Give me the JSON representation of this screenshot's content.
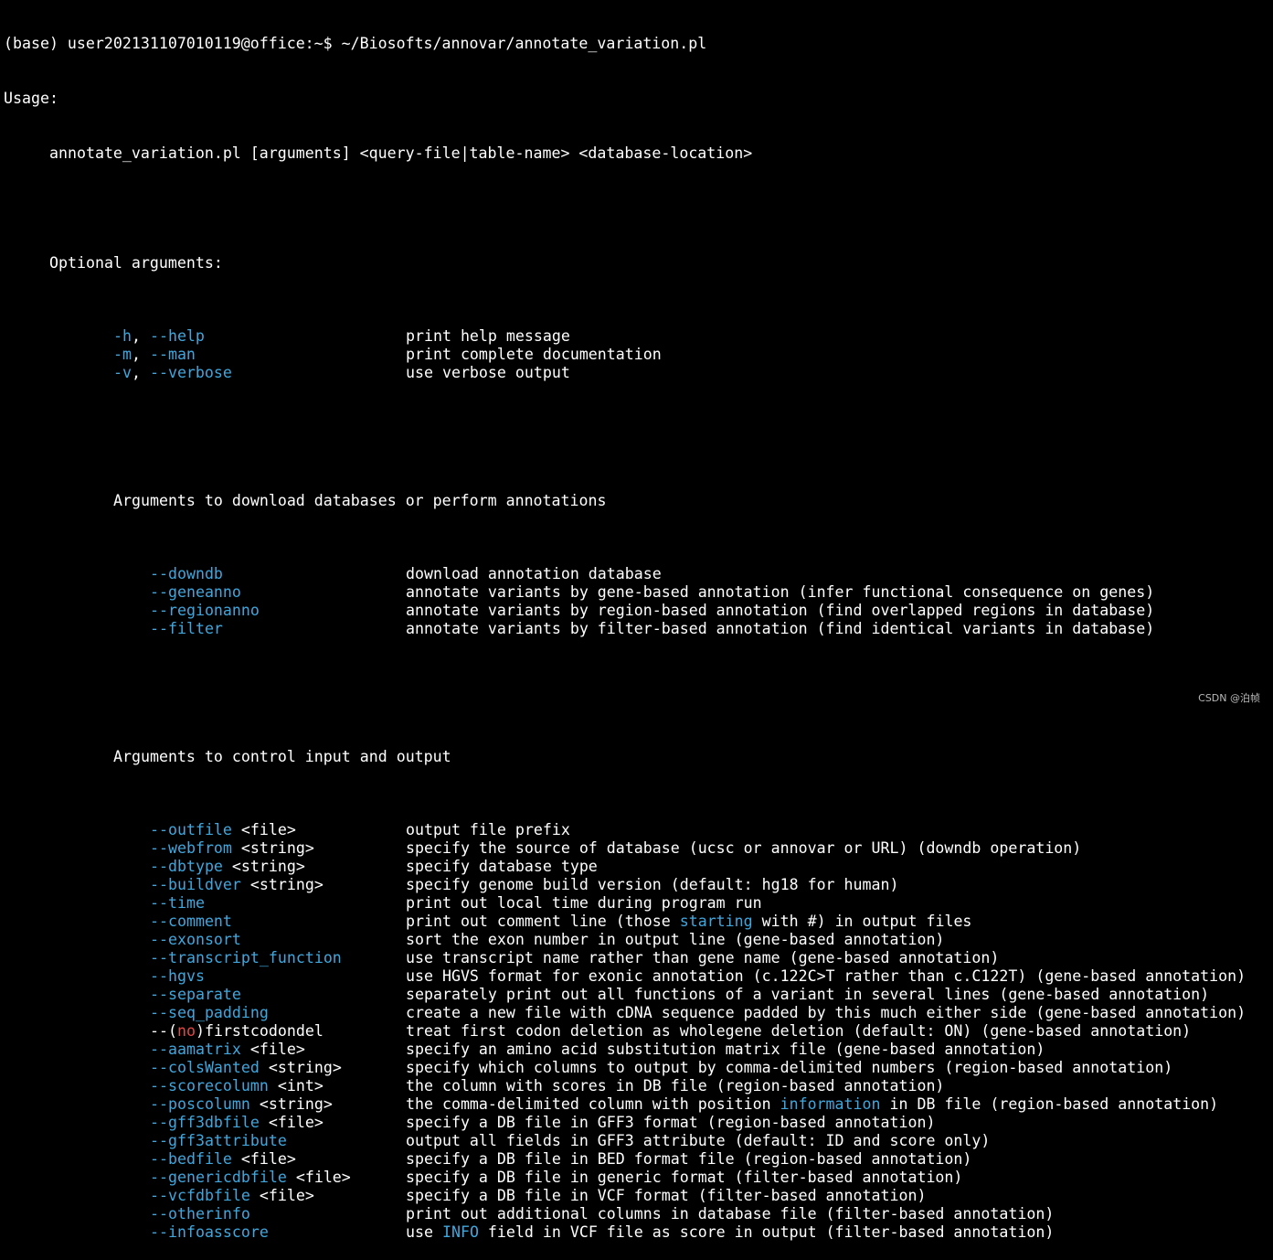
{
  "terminal": {
    "prompt_line": "(base) user202131107010119@office:~$ ~/Biosofts/annovar/annotate_variation.pl",
    "usage_label": "Usage:",
    "usage_line": "annotate_variation.pl [arguments] <query-file|table-name> <database-location>",
    "optional_header": "Optional arguments:",
    "section1": [
      {
        "opt": "-h, --help",
        "hl": "-h",
        "sep": ", ",
        "hl2": "--help",
        "rest": "",
        "desc": "print help message"
      },
      {
        "opt": "-m, --man",
        "hl": "-m",
        "sep": ", ",
        "hl2": "--man",
        "rest": "",
        "desc": "print complete documentation"
      },
      {
        "opt": "-v, --verbose",
        "hl": "-v",
        "sep": ", ",
        "hl2": "--verbose",
        "rest": "",
        "desc": "use verbose output"
      }
    ],
    "download_header": "Arguments to download databases or perform annotations",
    "section2": [
      {
        "hl": "--downdb",
        "rest": "",
        "desc": "download annotation database"
      },
      {
        "hl": "--geneanno",
        "rest": "",
        "desc": "annotate variants by gene-based annotation (infer functional consequence on genes)"
      },
      {
        "hl": "--regionanno",
        "rest": "",
        "desc": "annotate variants by region-based annotation (find overlapped regions in database)"
      },
      {
        "hl": "--filter",
        "rest": "",
        "desc": "annotate variants by filter-based annotation (find identical variants in database)"
      }
    ],
    "control_header": "Arguments to control input and output",
    "section3": [
      {
        "hl": "--outfile",
        "rest": " <file>",
        "desc": "output file prefix"
      },
      {
        "hl": "--webfrom",
        "rest": " <string>",
        "desc": "specify the source of database (ucsc or annovar or URL) (downdb operation)"
      },
      {
        "hl": "--dbtype",
        "rest": " <string>",
        "desc": "specify database type"
      },
      {
        "hl": "--buildver",
        "rest": " <string>",
        "desc": "specify genome build version (default: hg18 for human)"
      },
      {
        "hl": "--time",
        "rest": "",
        "desc": "print out local time during program run"
      },
      {
        "hl": "--comment",
        "rest": "",
        "desc_pre": "print out comment line (those ",
        "desc_hl": "starting",
        "desc_post": " with #) in output files"
      },
      {
        "hl": "--exonsort",
        "rest": "",
        "desc": "sort the exon number in output line (gene-based annotation)"
      },
      {
        "hl": "--transcript_function",
        "rest": "",
        "desc": "use transcript name rather than gene name (gene-based annotation)"
      },
      {
        "hl": "--hgvs",
        "rest": "",
        "desc": "use HGVS format for exonic annotation (c.122C>T rather than c.C122T) (gene-based annotation)"
      },
      {
        "hl": "--separate",
        "rest": "",
        "desc": "separately print out all functions of a variant in several lines (gene-based annotation)"
      },
      {
        "hl": "--seq_padding",
        "rest": "",
        "desc": "create a new file with cDNA sequence padded by this much either side (gene-based annotation)"
      },
      {
        "special": "nofirst",
        "pre": "--(",
        "red": "no",
        "post": ")firstcodondel",
        "desc": "treat first codon deletion as wholegene deletion (default: ON) (gene-based annotation)"
      },
      {
        "hl": "--aamatrix",
        "rest": " <file>",
        "desc": "specify an amino acid substitution matrix file (gene-based annotation)"
      },
      {
        "hl": "--colsWanted",
        "rest": " <string>",
        "desc": "specify which columns to output by comma-delimited numbers (region-based annotation)"
      },
      {
        "hl": "--scorecolumn",
        "rest": " <int>",
        "desc": "the column with scores in DB file (region-based annotation)"
      },
      {
        "hl": "--poscolumn",
        "rest": " <string>",
        "desc_pre": "the comma-delimited column with position ",
        "desc_hl": "information",
        "desc_post": " in DB file (region-based annotation)"
      },
      {
        "hl": "--gff3dbfile",
        "rest": " <file>",
        "desc": "specify a DB file in GFF3 format (region-based annotation)"
      },
      {
        "hl": "--gff3attribute",
        "rest": "",
        "desc": "output all fields in GFF3 attribute (default: ID and score only)"
      },
      {
        "hl": "--bedfile",
        "rest": " <file>",
        "desc": "specify a DB file in BED format file (region-based annotation)"
      },
      {
        "hl": "--genericdbfile",
        "rest": " <file>",
        "desc": "specify a DB file in generic format (filter-based annotation)"
      },
      {
        "hl": "--vcfdbfile",
        "rest": " <file>",
        "desc": "specify a DB file in VCF format (filter-based annotation)"
      },
      {
        "hl": "--otherinfo",
        "rest": "",
        "desc": "print out additional columns in database file (filter-based annotation)"
      },
      {
        "hl": "--infoasscore",
        "rest": "",
        "desc_pre": "use ",
        "desc_hl": "INFO",
        "desc_post": " field in VCF file as score in output (filter-based annotation)"
      }
    ]
  },
  "watermark": "CSDN @泊帧",
  "colors": {
    "background": "#000000",
    "text": "#ffffff",
    "option_highlight": "#3fa7de",
    "no_highlight": "#e04848"
  }
}
